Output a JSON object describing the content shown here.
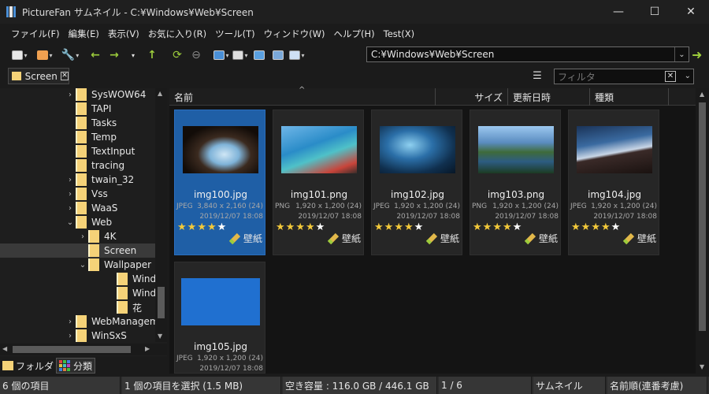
{
  "window": {
    "title": "PictureFan サムネイル - C:¥Windows¥Web¥Screen",
    "min": "—",
    "max": "☐",
    "close": "✕"
  },
  "menu": [
    "ファイル(F)",
    "編集(E)",
    "表示(V)",
    "お気に入り(R)",
    "ツール(T)",
    "ウィンドウ(W)",
    "ヘルプ(H)",
    "Test(X)"
  ],
  "toolbar": {
    "icons": [
      "new-window-icon",
      "open-folder-icon",
      "settings-wrench-icon",
      "back-arrow-icon",
      "forward-arrow-icon",
      "up-arrow-icon",
      "refresh-icon",
      "stop-icon",
      "view-mode-icon",
      "sort-icon",
      "image-view-icon",
      "slideshow-icon",
      "print-icon"
    ],
    "back": "←",
    "forward": "→",
    "up": "↑",
    "refresh": "⟳",
    "stop": "⊖",
    "caret": "▾"
  },
  "address": {
    "value": "C:¥Windows¥Web¥Screen",
    "go": "➜",
    "drop": "⌄"
  },
  "tab": {
    "label": "Screen",
    "close": "✕"
  },
  "filter": {
    "placeholder": "フィルタ",
    "clear": "✕",
    "drop": "⌄",
    "menu": "☰"
  },
  "tree": {
    "items": [
      {
        "label": "SysWOW64",
        "level": 0,
        "expander": "›"
      },
      {
        "label": "TAPI",
        "level": 0,
        "expander": ""
      },
      {
        "label": "Tasks",
        "level": 0,
        "expander": ""
      },
      {
        "label": "Temp",
        "level": 0,
        "expander": ""
      },
      {
        "label": "TextInput",
        "level": 0,
        "expander": ""
      },
      {
        "label": "tracing",
        "level": 0,
        "expander": ""
      },
      {
        "label": "twain_32",
        "level": 0,
        "expander": "›"
      },
      {
        "label": "Vss",
        "level": 0,
        "expander": "›"
      },
      {
        "label": "WaaS",
        "level": 0,
        "expander": "›"
      },
      {
        "label": "Web",
        "level": 0,
        "expander": "⌄"
      },
      {
        "label": "4K",
        "level": 1,
        "expander": "›"
      },
      {
        "label": "Screen",
        "level": 1,
        "expander": "",
        "selected": true
      },
      {
        "label": "Wallpaper",
        "level": 1,
        "expander": "⌄"
      },
      {
        "label": "Windo",
        "level": 2,
        "expander": ""
      },
      {
        "label": "Windo",
        "level": 2,
        "expander": ""
      },
      {
        "label": "花",
        "level": 2,
        "expander": ""
      },
      {
        "label": "WebManagem",
        "level": 0,
        "expander": "›"
      },
      {
        "label": "WinSxS",
        "level": 0,
        "expander": "›"
      }
    ],
    "scroll_up": "▲",
    "scroll_down": "▼",
    "scroll_left": "◀",
    "scroll_right": "▶"
  },
  "bottom_tabs": {
    "folders": "フォルダ",
    "classify": "分類"
  },
  "columns": {
    "name": "名前",
    "size": "サイズ",
    "date": "更新日時",
    "type": "種類",
    "sort": "^"
  },
  "content_scroll": {
    "up": "▲",
    "down": "▼"
  },
  "files": [
    {
      "name": "img100.jpg",
      "type": "JPEG",
      "dims": "3,840 x 2,160 (24)",
      "date": "2019/12/07 18:08",
      "rating": 4,
      "tag": "壁紙",
      "selected": true
    },
    {
      "name": "img101.png",
      "type": "PNG",
      "dims": "1,920 x 1,200 (24)",
      "date": "2019/12/07 18:08",
      "rating": 4,
      "tag": "壁紙",
      "selected": false
    },
    {
      "name": "img102.jpg",
      "type": "JPEG",
      "dims": "1,920 x 1,200 (24)",
      "date": "2019/12/07 18:08",
      "rating": 4,
      "tag": "壁紙",
      "selected": false
    },
    {
      "name": "img103.png",
      "type": "PNG",
      "dims": "1,920 x 1,200 (24)",
      "date": "2019/12/07 18:08",
      "rating": 4,
      "tag": "壁紙",
      "selected": false
    },
    {
      "name": "img104.jpg",
      "type": "JPEG",
      "dims": "1,920 x 1,200 (24)",
      "date": "2019/12/07 18:08",
      "rating": 4,
      "tag": "壁紙",
      "selected": false
    },
    {
      "name": "img105.jpg",
      "type": "JPEG",
      "dims": "1,920 x 1,200 (24)",
      "date": "2019/12/07 18:08",
      "rating": 0,
      "tag": "",
      "selected": false
    }
  ],
  "status": {
    "count": "6 個の項目",
    "selection": "1 個の項目を選択 (1.5 MB)",
    "space": "空き容量 : 116.0 GB / 446.1 GB",
    "page": "1 / 6",
    "mode": "サムネイル",
    "sort": "名前順(連番考慮)"
  }
}
